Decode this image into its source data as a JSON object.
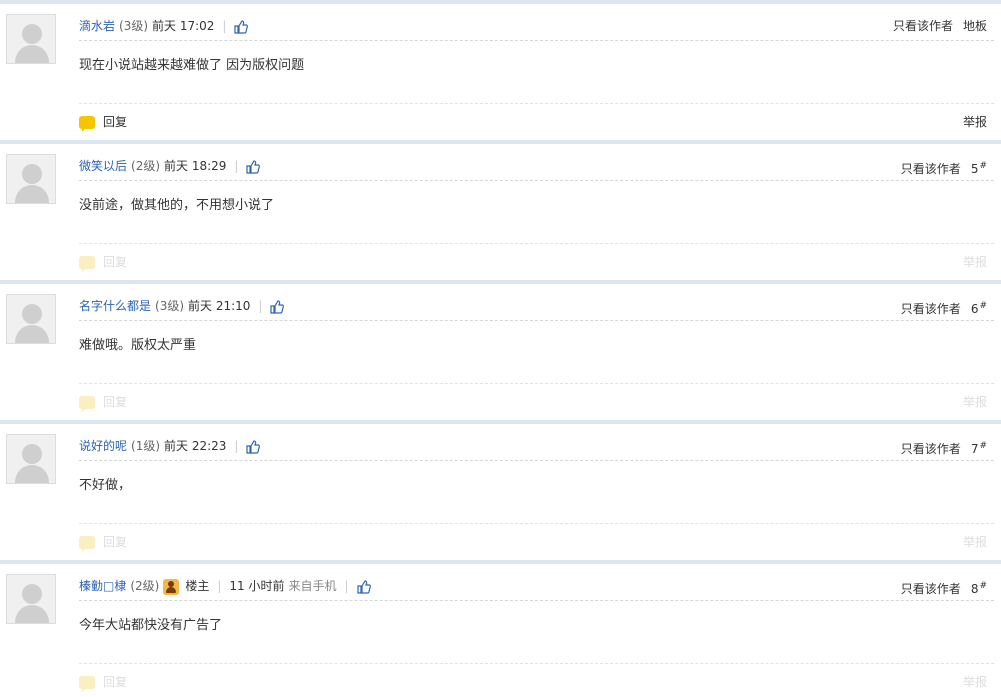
{
  "posts": [
    {
      "username": "滴水岩",
      "level": "(3级)",
      "time": "前天 17:02",
      "only_author": "只看该作者",
      "floor": "地板",
      "floor_mark": "",
      "content": "现在小说站越来越难做了 因为版权问题",
      "reply": "回复",
      "report": "举报"
    },
    {
      "username": "微笑以后",
      "level": "(2级)",
      "time": "前天 18:29",
      "only_author": "只看该作者",
      "floor": "5",
      "floor_mark": "#",
      "content": "没前途，做其他的，不用想小说了",
      "reply": "回复",
      "report": "举报"
    },
    {
      "username": "名字什么都是",
      "level": "(3级)",
      "time": "前天 21:10",
      "only_author": "只看该作者",
      "floor": "6",
      "floor_mark": "#",
      "content": "难做哦。版权太严重",
      "reply": "回复",
      "report": "举报"
    },
    {
      "username": "说好的呢",
      "level": "(1级)",
      "time": "前天 22:23",
      "only_author": "只看该作者",
      "floor": "7",
      "floor_mark": "#",
      "content": "不好做，",
      "reply": "回复",
      "report": "举报"
    },
    {
      "username": "榛勭□棣",
      "level": "(2级)",
      "owner_label": "楼主",
      "time": "11 小时前",
      "source": "来自手机",
      "only_author": "只看该作者",
      "floor": "8",
      "floor_mark": "#",
      "content": "今年大站都快没有广告了",
      "reply": "回复",
      "report": "举报"
    }
  ]
}
